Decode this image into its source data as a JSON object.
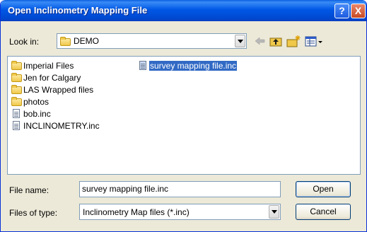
{
  "window": {
    "title": "Open Inclinometry Mapping File",
    "help_label": "?",
    "close_label": "X"
  },
  "look_in": {
    "label": "Look in:",
    "value": "DEMO"
  },
  "files": [
    {
      "name": "Imperial Files",
      "type": "folder"
    },
    {
      "name": "Jen for Calgary",
      "type": "folder"
    },
    {
      "name": "LAS Wrapped files",
      "type": "folder"
    },
    {
      "name": "photos",
      "type": "folder"
    },
    {
      "name": "bob.inc",
      "type": "file"
    },
    {
      "name": "INCLINOMETRY.inc",
      "type": "file"
    },
    {
      "name": "survey mapping file.inc",
      "type": "file",
      "selected": true
    }
  ],
  "file_name": {
    "label": "File name:",
    "value": "survey mapping file.inc"
  },
  "file_type": {
    "label": "Files of type:",
    "value": "Inclinometry Map files (*.inc)"
  },
  "buttons": {
    "open": "Open",
    "cancel": "Cancel"
  }
}
